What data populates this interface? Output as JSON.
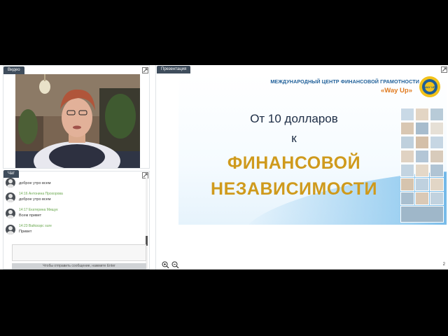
{
  "video": {
    "tab_label": "Видео"
  },
  "chat": {
    "tab_label": "Чат",
    "messages": [
      {
        "meta": "",
        "text": "доброе утро всем"
      },
      {
        "meta": "14:16 Антонина Прохорова",
        "text": "доброе утро всем"
      },
      {
        "meta": "14:17 Екатерина Мищук",
        "text": "Всем привет"
      },
      {
        "meta": "14:23 Вайсвэрс sure",
        "text": "Привет"
      }
    ],
    "input_hint": "Чтобы отправить сообщение, нажмите Enter"
  },
  "presentation": {
    "tab_label": "Презентация",
    "slide": {
      "org_name": "МЕЖДУНАРОДНЫЙ ЦЕНТР ФИНАНСОВОЙ ГРАМОТНОСТИ",
      "brand": "«Way Up»",
      "logo_text": "WAY UP",
      "line1": "От 10 долларов",
      "line2": "к",
      "line3": "ФИНАНСОВОЙ",
      "line4": "НЕЗАВИСИМОСТИ"
    },
    "page_number": "2"
  },
  "colors": {
    "tab_bg": "#3f4d5c",
    "accent_blue": "#1f5f99",
    "brand_orange": "#e07a1e",
    "title_gold": "#cf9a1c",
    "chat_meta_green": "#6aa84f"
  }
}
